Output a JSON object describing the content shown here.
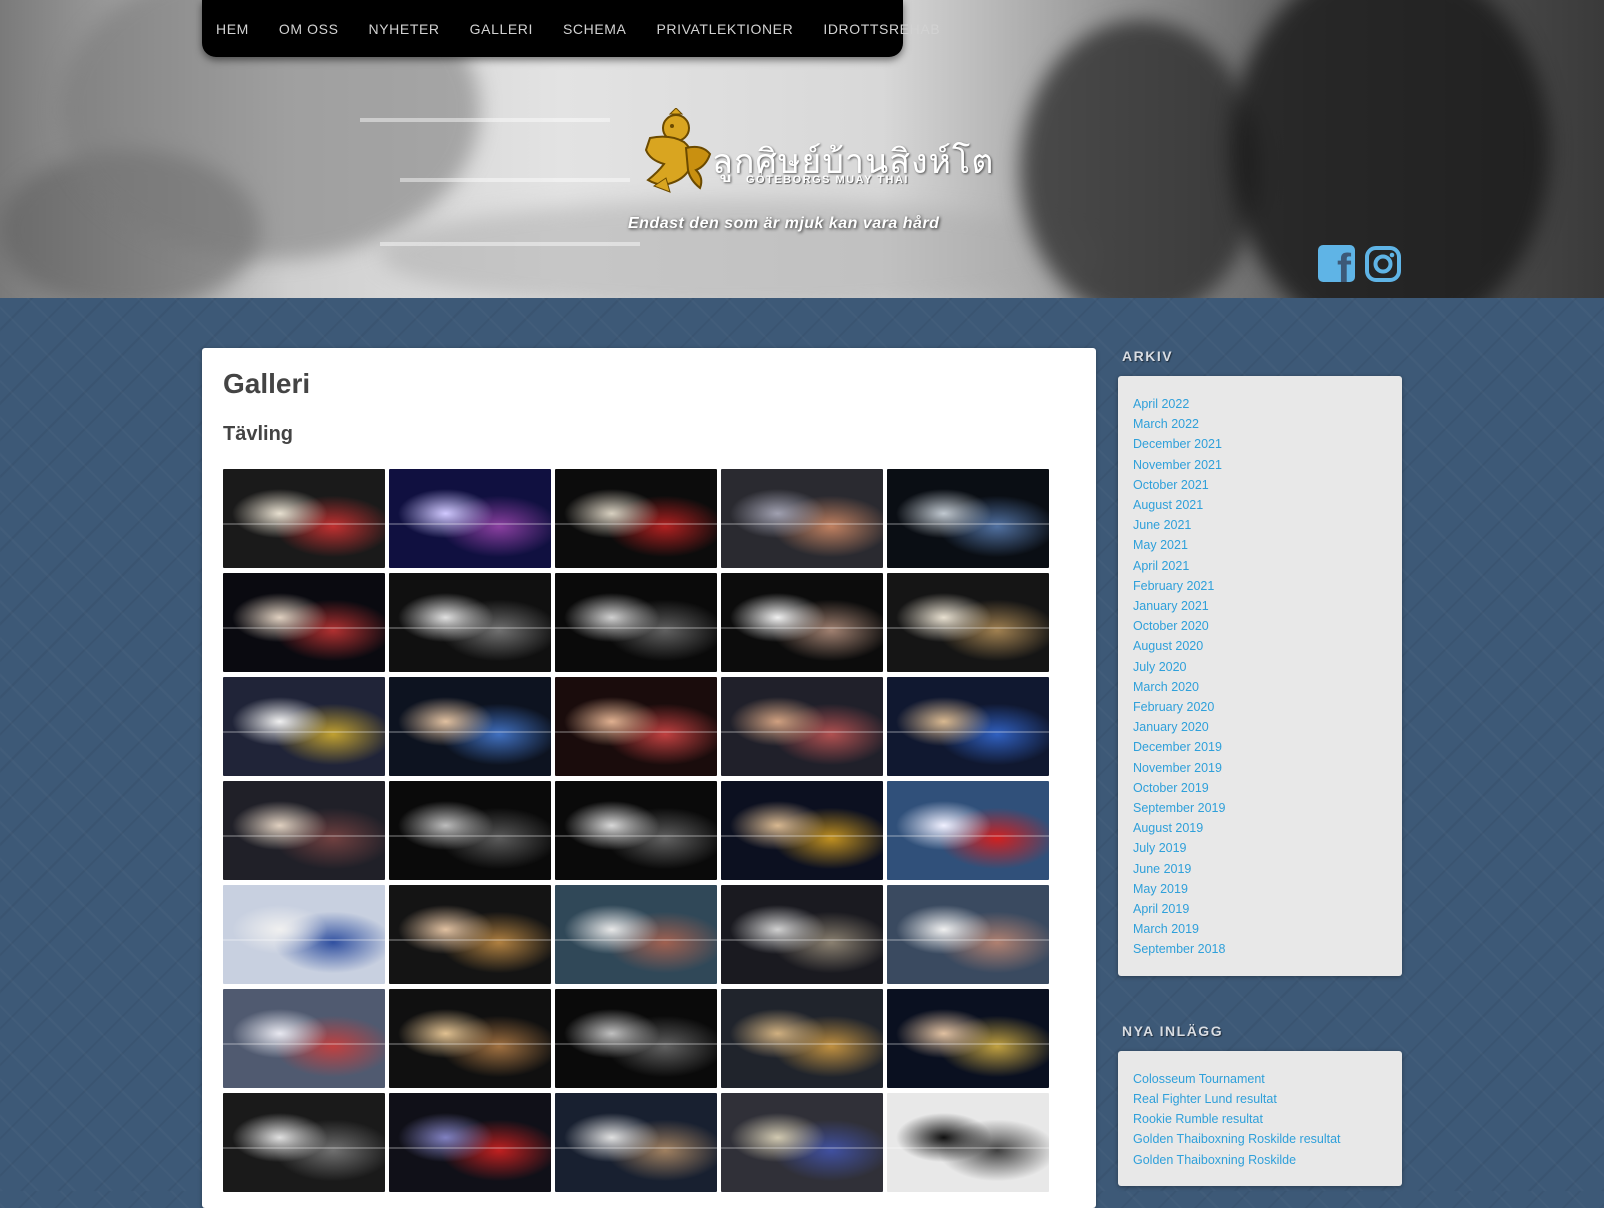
{
  "nav": {
    "items": [
      "HEM",
      "OM OSS",
      "NYHETER",
      "GALLERI",
      "SCHEMA",
      "PRIVATLEKTIONER",
      "IDROTTSREHAB"
    ]
  },
  "header": {
    "logo_text_thai": "ลูกศิษย์บ้านสิงห์โต",
    "logo_subtitle": "GÖTEBORGS MUAY THAI",
    "tagline": "Endast den som är mjuk kan vara hård"
  },
  "social": {
    "facebook_icon": "facebook-icon",
    "instagram_icon": "instagram-icon",
    "facebook_color": "#5fb4e6",
    "instagram_color": "#5fb4e6"
  },
  "main": {
    "title": "Galleri",
    "section": "Tävling",
    "photo_count": 35
  },
  "sidebar": {
    "archive_title": "ARKIV",
    "archive_items": [
      "April 2022",
      "March 2022",
      "December 2021",
      "November 2021",
      "October 2021",
      "August 2021",
      "June 2021",
      "May 2021",
      "April 2021",
      "February 2021",
      "January 2021",
      "October 2020",
      "August 2020",
      "July 2020",
      "March 2020",
      "February 2020",
      "January 2020",
      "December 2019",
      "November 2019",
      "October 2019",
      "September 2019",
      "August 2019",
      "July 2019",
      "June 2019",
      "May 2019",
      "April 2019",
      "March 2019",
      "September 2018"
    ],
    "recent_title": "NYA INLÄGG",
    "recent_items": [
      "Colosseum Tournament",
      "Real Fighter Lund resultat",
      "Rookie Rumble resultat",
      "Golden Thaiboxning Roskilde resultat",
      "Golden Thaiboxning Roskilde"
    ]
  },
  "colors": {
    "background": "#3d5977",
    "link": "#2fa0da",
    "nav_bg": "#000000"
  }
}
